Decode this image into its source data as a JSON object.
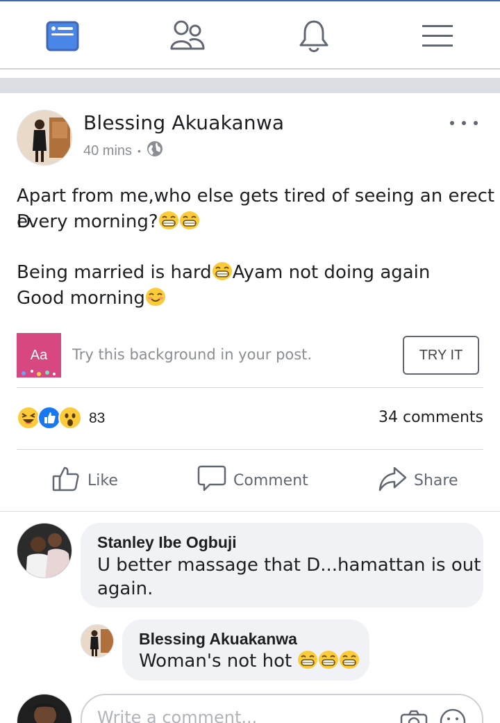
{
  "nav": {
    "items": [
      {
        "name": "news-feed",
        "icon": "news-feed-icon",
        "active": true
      },
      {
        "name": "friends",
        "icon": "friends-icon",
        "active": false
      },
      {
        "name": "notifications",
        "icon": "bell-icon",
        "active": false
      },
      {
        "name": "menu",
        "icon": "hamburger-menu-icon",
        "active": false
      }
    ],
    "accent": "#4267b2"
  },
  "post": {
    "author": "Blessing Akuakanwa",
    "time": "40 mins",
    "separator": "•",
    "privacy_icon": "globe-icon",
    "line1": "Apart from me,who else gets tired of seeing an erect D",
    "line2": "every morning?",
    "line3a": "Being married is hard",
    "line3b": "Ayam not doing again",
    "line4": "Good morning"
  },
  "background_suggestion": {
    "thumb_label": "Aa",
    "hint": "Try this background in your post.",
    "button": "TRY IT"
  },
  "stats": {
    "reactions": [
      "laughing-reaction",
      "like-reaction",
      "wow-reaction"
    ],
    "reaction_count": "83",
    "comments": "34 comments"
  },
  "actions": {
    "like": "Like",
    "comment": "Comment",
    "share": "Share"
  },
  "comments": [
    {
      "author": "Stanley Ibe Ogbuji",
      "text_line1": "U better massage that D...hamattan is out",
      "text_line2": "again."
    },
    {
      "author": "Blessing Akuakanwa",
      "text": "Woman's not hot "
    }
  ],
  "composer": {
    "placeholder": "Write a comment..."
  }
}
